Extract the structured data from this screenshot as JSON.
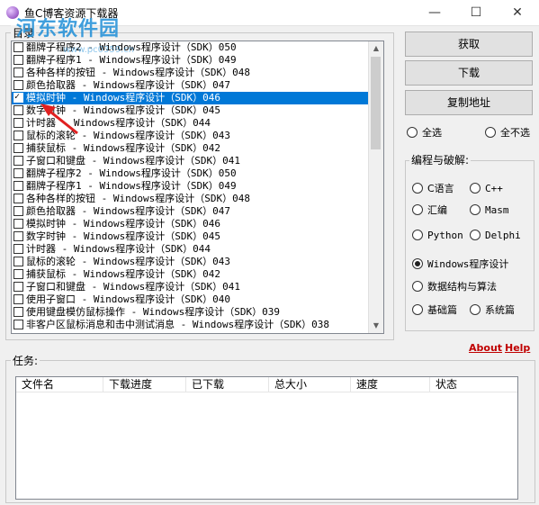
{
  "window": {
    "title": "鱼C博客资源下载器",
    "minimize": "—",
    "maximize": "☐",
    "close": "✕"
  },
  "watermark": {
    "logo": "河东软件园",
    "site": "www.pc0359.cn"
  },
  "catalog": {
    "label": "目录",
    "items": [
      {
        "text": "翻牌子程序2 - Windows程序设计（SDK）050",
        "checked": false,
        "selected": false
      },
      {
        "text": "翻牌子程序1 - Windows程序设计（SDK）049",
        "checked": false,
        "selected": false
      },
      {
        "text": "各种各样的按钮 - Windows程序设计（SDK）048",
        "checked": false,
        "selected": false
      },
      {
        "text": "颜色拾取器 - Windows程序设计（SDK）047",
        "checked": false,
        "selected": false
      },
      {
        "text": "模拟时钟 - Windows程序设计（SDK）046",
        "checked": true,
        "selected": true
      },
      {
        "text": "数字时钟 - Windows程序设计（SDK）045",
        "checked": false,
        "selected": false
      },
      {
        "text": "计时器 - Windows程序设计（SDK）044",
        "checked": false,
        "selected": false
      },
      {
        "text": "鼠标的滚轮 - Windows程序设计（SDK）043",
        "checked": false,
        "selected": false
      },
      {
        "text": "捕获鼠标 - Windows程序设计（SDK）042",
        "checked": false,
        "selected": false
      },
      {
        "text": "子窗口和键盘 - Windows程序设计（SDK）041",
        "checked": false,
        "selected": false
      },
      {
        "text": "翻牌子程序2 - Windows程序设计（SDK）050",
        "checked": false,
        "selected": false
      },
      {
        "text": "翻牌子程序1 - Windows程序设计（SDK）049",
        "checked": false,
        "selected": false
      },
      {
        "text": "各种各样的按钮 - Windows程序设计（SDK）048",
        "checked": false,
        "selected": false
      },
      {
        "text": "颜色拾取器 - Windows程序设计（SDK）047",
        "checked": false,
        "selected": false
      },
      {
        "text": "模拟时钟 - Windows程序设计（SDK）046",
        "checked": false,
        "selected": false
      },
      {
        "text": "数字时钟 - Windows程序设计（SDK）045",
        "checked": false,
        "selected": false
      },
      {
        "text": "计时器 - Windows程序设计（SDK）044",
        "checked": false,
        "selected": false
      },
      {
        "text": "鼠标的滚轮 - Windows程序设计（SDK）043",
        "checked": false,
        "selected": false
      },
      {
        "text": "捕获鼠标 - Windows程序设计（SDK）042",
        "checked": false,
        "selected": false
      },
      {
        "text": "子窗口和键盘 - Windows程序设计（SDK）041",
        "checked": false,
        "selected": false
      },
      {
        "text": "使用子窗口 - Windows程序设计（SDK）040",
        "checked": false,
        "selected": false
      },
      {
        "text": "使用键盘模仿鼠标操作 - Windows程序设计（SDK）039",
        "checked": false,
        "selected": false
      },
      {
        "text": "非客户区鼠标消息和击中测试消息 - Windows程序设计（SDK）038",
        "checked": false,
        "selected": false
      }
    ]
  },
  "buttons": {
    "fetch": "获取",
    "download": "下载",
    "copy_address": "复制地址"
  },
  "select": {
    "all": "全选",
    "none": "全不选"
  },
  "category": {
    "label": "编程与破解:",
    "options": {
      "c": "C语言",
      "cpp": "C++",
      "asm": "汇编",
      "masm": "Masm",
      "python": "Python",
      "delphi": "Delphi",
      "win": "Windows程序设计",
      "ds": "数据结构与算法",
      "basic": "基础篇",
      "system": "系统篇"
    },
    "selected": "win"
  },
  "links": {
    "about": "About",
    "help": "Help"
  },
  "tasks": {
    "label": "任务:",
    "columns": [
      "文件名",
      "下载进度",
      "已下载",
      "总大小",
      "速度",
      "状态"
    ]
  },
  "colors": {
    "selection": "#0078d7",
    "link": "#c00000",
    "annotation_arrow": "#e02020",
    "watermark": "#1f8fd8"
  }
}
